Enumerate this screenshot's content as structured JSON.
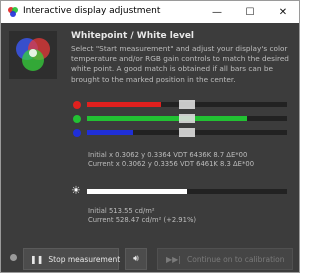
{
  "window": {
    "title": "Interactive display adjustment",
    "controls": {
      "minimize": "—",
      "maximize": "☐",
      "close": "✕"
    }
  },
  "main": {
    "heading": "Whitepoint / White level",
    "description": "Select \"Start measurement\" and adjust your display's color temperature and/or RGB gain controls to match the desired white point. A good match is obtained if all bars can be brought to the marked position in the center."
  },
  "bars": [
    {
      "name": "red",
      "color": "#e0201e",
      "fill_fraction": 0.37
    },
    {
      "name": "green",
      "color": "#22c233",
      "fill_fraction": 0.8
    },
    {
      "name": "blue",
      "color": "#1f2fd8",
      "fill_fraction": 0.23
    }
  ],
  "rgb_readout": {
    "initial": "Initial x 0.3062 y 0.3364 VDT 6436K 8.7 ΔE*00",
    "current": "Current x 0.3062 y 0.3356 VDT 6461K 8.3 ΔE*00"
  },
  "luminance": {
    "fill_fraction": 0.5,
    "color": "#ffffff",
    "initial": "Initial 513.55 cd/m²",
    "current": "Current 528.47 cd/m² (+2.91%)"
  },
  "footer": {
    "stop_label": "Stop measurement",
    "continue_label": "Continue on to calibration"
  }
}
